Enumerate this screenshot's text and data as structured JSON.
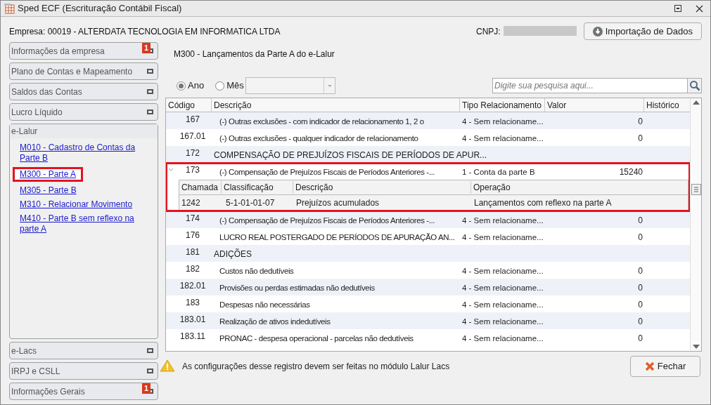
{
  "window": {
    "title": "Sped ECF (Escrituração Contábil Fiscal)"
  },
  "company": "Empresa: 00019 - ALTERDATA TECNOLOGIA EM INFORMATICA LTDA",
  "cnpj_label": "CNPJ:",
  "import_button": "Importação de Dados",
  "sidebar": {
    "top_sections": [
      {
        "label": "Informações da empresa",
        "badge": "1"
      },
      {
        "label": "Plano de Contas e Mapeamento"
      },
      {
        "label": "Saldos das Contas"
      },
      {
        "label": "Lucro Líquido"
      }
    ],
    "open_section": {
      "label": "e-Lalur",
      "items": [
        {
          "label": "M010 - Cadastro de Contas da Parte B",
          "highlighted": false
        },
        {
          "label": "M300 - Parte A",
          "highlighted": true
        },
        {
          "label": "M305 - Parte B",
          "highlighted": false
        },
        {
          "label": "M310 - Relacionar Movimento",
          "highlighted": false
        },
        {
          "label": "M410 - Parte B sem reflexo na parte A",
          "highlighted": false
        }
      ]
    },
    "bottom_sections": [
      {
        "label": "e-Lacs"
      },
      {
        "label": "IRPJ e CSLL"
      },
      {
        "label": "Informações Gerais",
        "badge": "1"
      }
    ]
  },
  "page_title": "M300 - Lançamentos da Parte A do e-Lalur",
  "period": [
    {
      "label": "Ano",
      "selected": true
    },
    {
      "label": "Mês",
      "selected": false
    }
  ],
  "search": {
    "placeholder": "Digite sua pesquisa aqui..."
  },
  "table": {
    "columns": [
      "Código",
      "Descrição",
      "Tipo Relacionamento",
      "Valor",
      "Histórico"
    ],
    "rows": [
      {
        "kind": "account",
        "code": "167",
        "description": "(-) Outras exclusões - com indicador de relacionamento 1, 2 o",
        "type": "4 - Sem relacioname...",
        "value": "0"
      },
      {
        "kind": "account",
        "code": "167.01",
        "description": "(-) Outras exclusões - qualquer indicador de relacionamento",
        "type": "4 - Sem relacioname...",
        "value": "0"
      },
      {
        "kind": "group",
        "code": "172",
        "description": "COMPENSAÇÃO DE PREJUÍZOS FISCAIS DE PERÍODOS DE APUR..."
      },
      {
        "kind": "account",
        "code": "173",
        "description": "(-) Compensação de Prejuízos Fiscais de Períodos Anteriores -...",
        "type": "1 - Conta da parte B",
        "value": "15240",
        "expanded": true,
        "highlighted": true,
        "detail": {
          "columns": [
            "Chamada",
            "Classificação",
            "Descrição",
            "Operação"
          ],
          "rows": [
            [
              "1242",
              "5-1-01-01-07",
              "Prejuízos acumulados",
              "Lançamentos com reflexo na parte A"
            ]
          ]
        }
      },
      {
        "kind": "account",
        "code": "174",
        "description": "(-) Compensação de Prejuízos Fiscais de Períodos Anteriores -...",
        "type": "4 - Sem relacioname...",
        "value": "0"
      },
      {
        "kind": "account",
        "code": "176",
        "description": "LUCRO REAL POSTERGADO DE PERÍODOS DE APURAÇÃO AN...",
        "type": "4 - Sem relacioname...",
        "value": "0"
      },
      {
        "kind": "group",
        "code": "181",
        "description": "ADIÇÕES"
      },
      {
        "kind": "account",
        "code": "182",
        "description": "Custos não dedutíveis",
        "type": "4 - Sem relacioname...",
        "value": "0"
      },
      {
        "kind": "account",
        "code": "182.01",
        "description": "Provisões ou perdas estimadas não dedutíveis",
        "type": "4 - Sem relacioname...",
        "value": "0"
      },
      {
        "kind": "account",
        "code": "183",
        "description": "Despesas não necessárias",
        "type": "4 - Sem relacioname...",
        "value": "0"
      },
      {
        "kind": "account",
        "code": "183.01",
        "description": "Realização de ativos indedutíveis",
        "type": "4 - Sem relacioname...",
        "value": "0"
      },
      {
        "kind": "account",
        "code": "183.11",
        "description": "PRONAC - despesa operacional - parcelas não dedutíveis",
        "type": "4 - Sem relacioname...",
        "value": "0"
      }
    ]
  },
  "warning": "As configurações desse registro devem ser feitas no módulo Lalur Lacs",
  "close_button": "Fechar"
}
